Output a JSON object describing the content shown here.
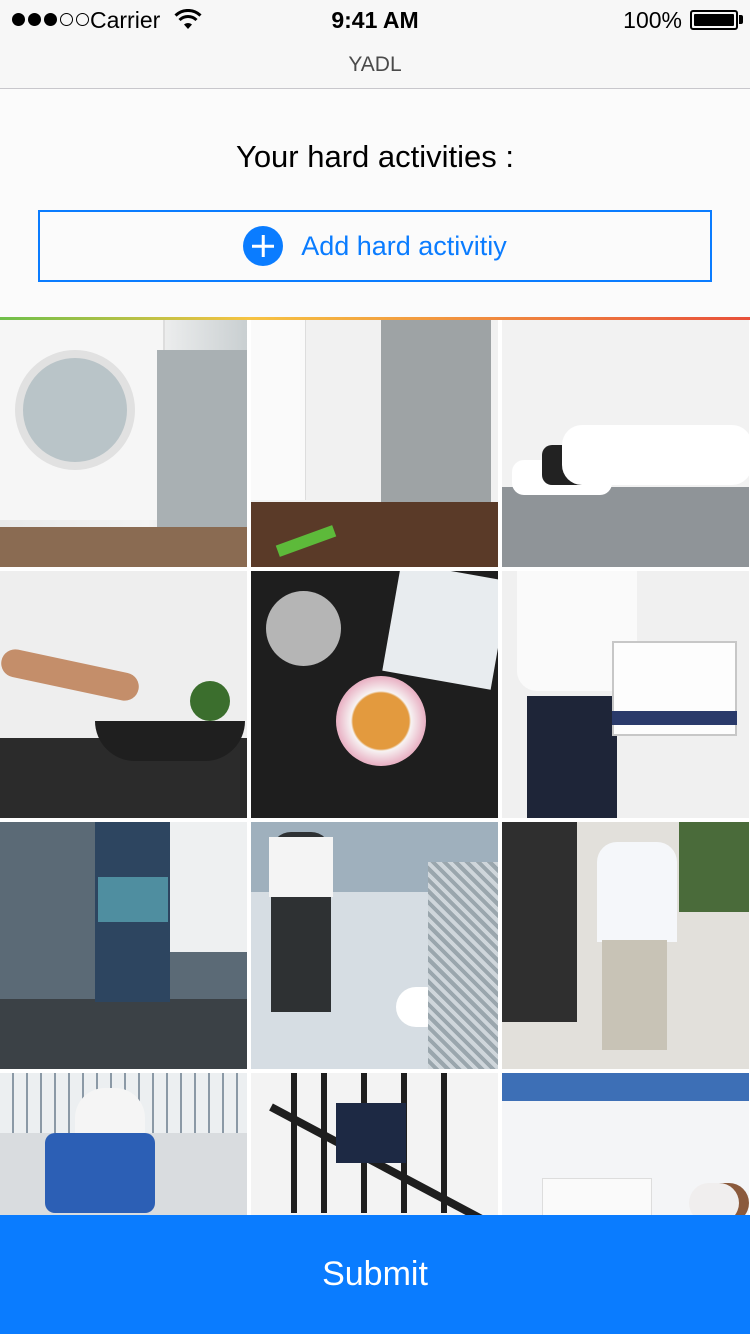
{
  "status_bar": {
    "carrier": "Carrier",
    "time": "9:41 AM",
    "battery": "100%",
    "signal_strength_of_5": 3
  },
  "nav": {
    "title": "YADL"
  },
  "main": {
    "heading": "Your hard activities :",
    "add_button_label": "Add hard activitiy",
    "tiles": [
      {
        "icon": "laundry-photo"
      },
      {
        "icon": "mopping-photo"
      },
      {
        "icon": "lying-in-bed-photo"
      },
      {
        "icon": "cooking-photo"
      },
      {
        "icon": "tea-cup-photo"
      },
      {
        "icon": "carrying-box-photo"
      },
      {
        "icon": "train-platform-photo"
      },
      {
        "icon": "walking-dog-photo"
      },
      {
        "icon": "walking-street-photo"
      },
      {
        "icon": "cycling-photo"
      },
      {
        "icon": "climbing-stairs-photo"
      },
      {
        "icon": "computer-work-photo"
      }
    ]
  },
  "submit_label": "Submit",
  "colors": {
    "accent": "#0a7cff",
    "nav_background": "#f7f7f7"
  }
}
